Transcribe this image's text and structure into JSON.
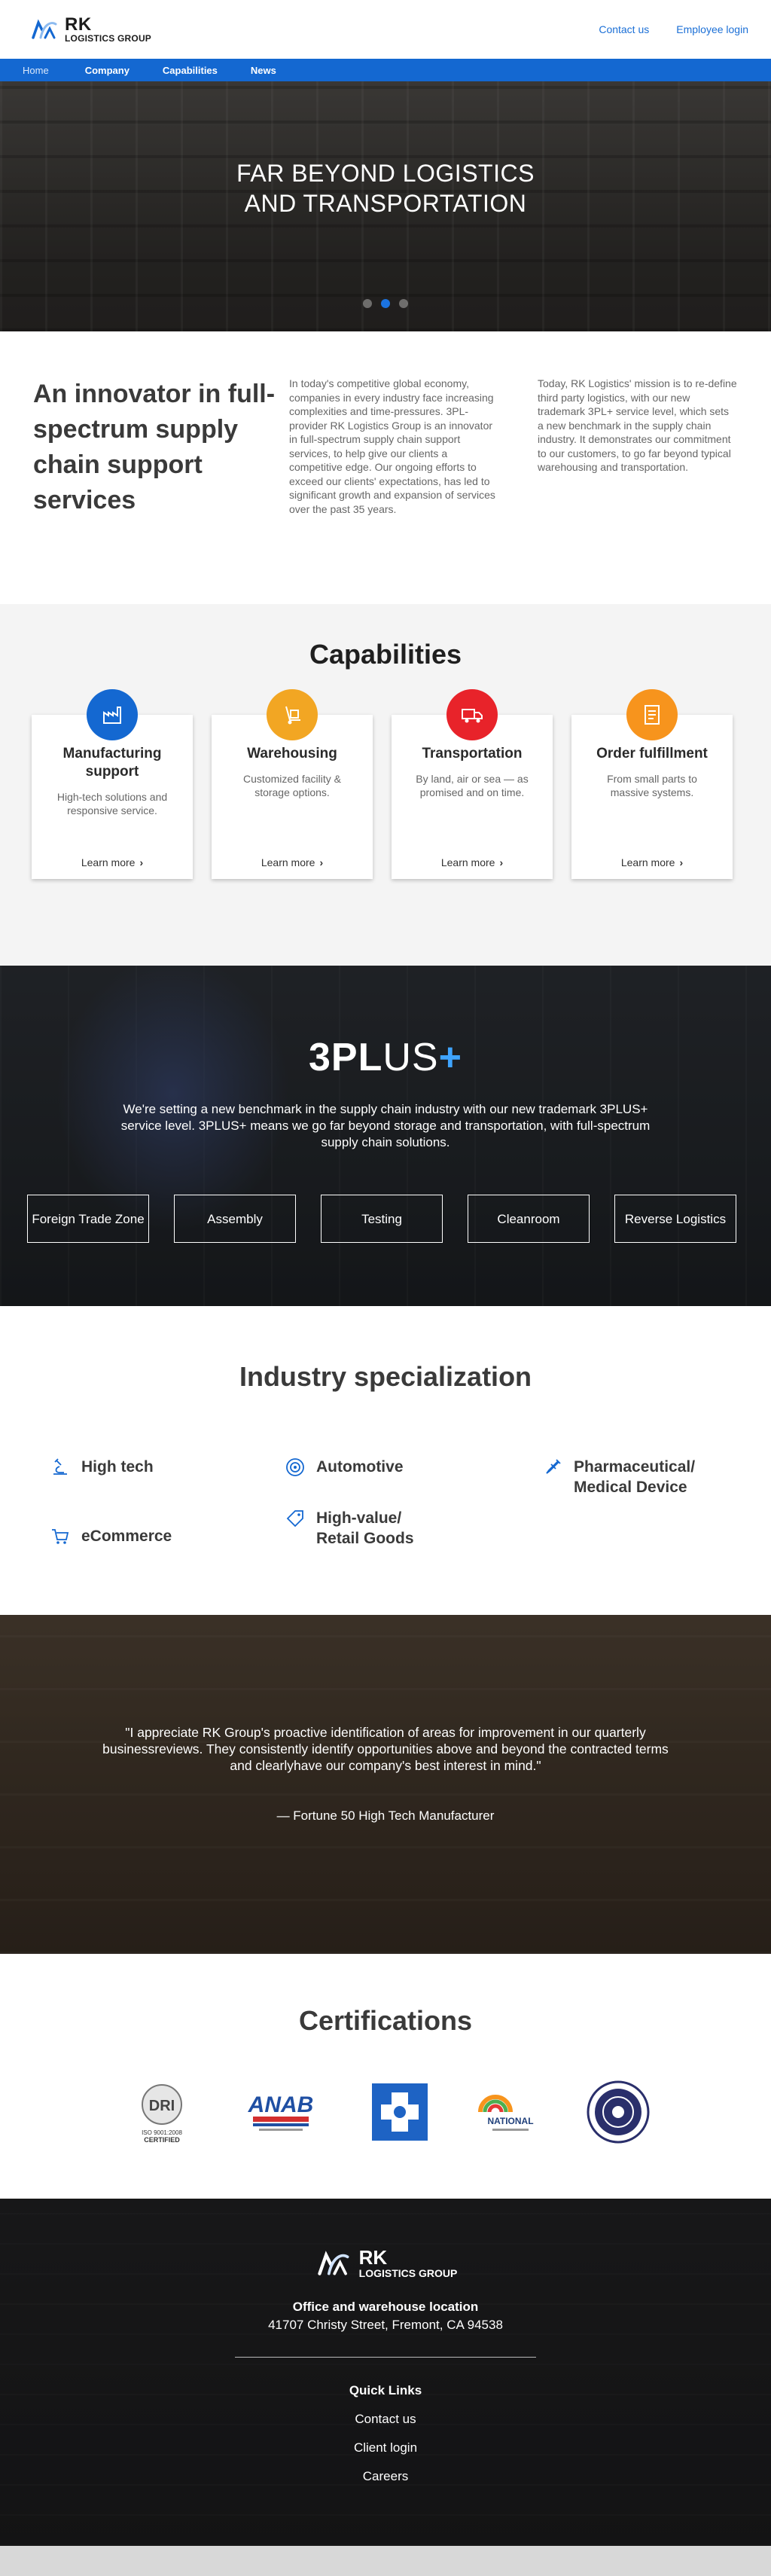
{
  "brand": {
    "name": "RK",
    "subname": "LOGISTICS GROUP",
    "accent": "#1468d1"
  },
  "header": {
    "util_links": [
      "Contact us",
      "Employee login"
    ],
    "nav": [
      "Home",
      "Company",
      "Capabilities",
      "News"
    ]
  },
  "hero": {
    "title_line1": "FAR BEYOND LOGISTICS",
    "title_line2": "AND TRANSPORTATION"
  },
  "intro": {
    "heading": "An innovator in full-spectrum supply chain support services",
    "col1": "In today's competitive global economy, companies in every industry face increasing complexities and time-pressures. 3PL-provider RK Logistics Group is an innovator in full-spectrum supply chain support services, to help give our clients a competitive edge. Our ongoing efforts to exceed our clients' expectations, has led to significant growth and expansion of services over the past 35 years.",
    "col2": "Today, RK Logistics' mission is to re-define third party logistics, with our new trademark 3PL+ service level, which sets a new benchmark in the supply chain industry. It demonstrates our commitment to our customers, to go far beyond typical warehousing and transportation."
  },
  "capabilities": {
    "title": "Capabilities",
    "cards": [
      {
        "title": "Manufacturing support",
        "desc": "High-tech solutions and responsive service.",
        "more": "Learn more",
        "icon": "factory-icon",
        "color": "#1468d1"
      },
      {
        "title": "Warehousing",
        "desc": "Customized facility & storage options.",
        "more": "Learn more",
        "icon": "hand-truck-icon",
        "color": "#f2a623"
      },
      {
        "title": "Transportation",
        "desc": "By land, air or sea — as promised and on time.",
        "more": "Learn more",
        "icon": "truck-icon",
        "color": "#e8232a"
      },
      {
        "title": "Order fulfillment",
        "desc": "From small parts to massive systems.",
        "more": "Learn more",
        "icon": "order-list-icon",
        "color": "#f7941d"
      }
    ]
  },
  "plus": {
    "logo_bold": "3PL",
    "logo_light": "US",
    "logo_cross": "+",
    "text": "We're setting a new benchmark in the supply chain industry with our new trademark 3PLUS+ service level. 3PLUS+ means we go far beyond storage and transportation, with full-spectrum supply chain solutions.",
    "buttons": [
      "Foreign Trade Zone",
      "Assembly",
      "Testing",
      "Cleanroom",
      "Reverse Logistics"
    ]
  },
  "industry": {
    "title": "Industry specialization",
    "items": [
      {
        "label": "High tech",
        "icon": "microscope-icon"
      },
      {
        "label": "Automotive",
        "icon": "wheel-icon"
      },
      {
        "label": "Pharmaceutical/ Medical Device",
        "icon": "syringe-icon"
      },
      {
        "label": "eCommerce",
        "icon": "cart-icon"
      },
      {
        "label": "High-value/ Retail Goods",
        "icon": "tag-icon"
      }
    ]
  },
  "testimonial": {
    "quote": "\"I appreciate RK Group's proactive identification of areas for improvement in our quarterly businessreviews. They consistently identify opportunities above and beyond the contracted terms and clearlyhave our company's best interest in mind.\"",
    "source": "— Fortune 50 High Tech Manufacturer"
  },
  "certifications": {
    "title": "Certifications",
    "logos": [
      {
        "name": "iso-9001-certified-logo",
        "text": "ISO 9001:2008 CERTIFIED"
      },
      {
        "name": "anab-logo",
        "text": "ANAB"
      },
      {
        "name": "medical-cross-logo",
        "text": ""
      },
      {
        "name": "national-msdc-logo",
        "text": "NATIONAL"
      },
      {
        "name": "seal-logo",
        "text": ""
      }
    ]
  },
  "footer": {
    "office_label": "Office and warehouse location",
    "address": "41707 Christy Street, Fremont, CA 94538",
    "quick_links_title": "Quick Links",
    "links": [
      "Contact us",
      "Client login",
      "Careers"
    ]
  }
}
